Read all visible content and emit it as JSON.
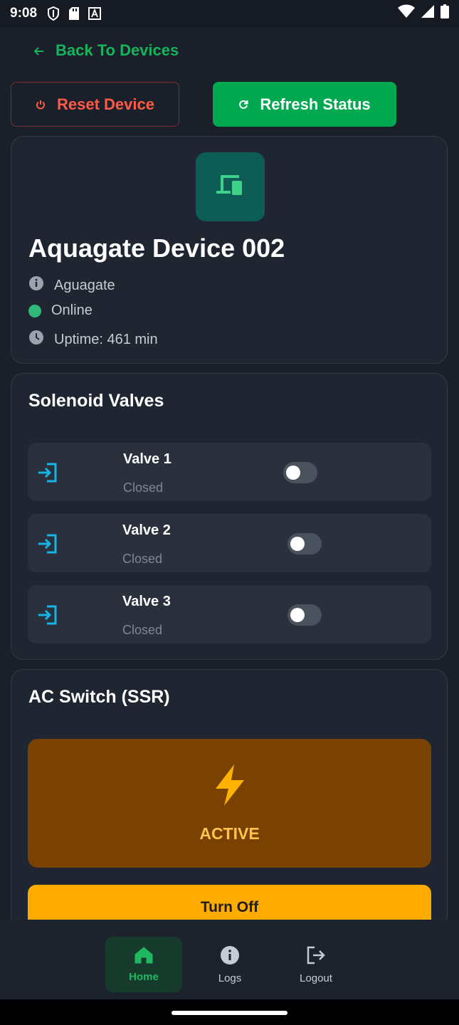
{
  "status_bar": {
    "time": "9:08",
    "icons": [
      "shield-icon",
      "sd-card-icon",
      "font-a-icon"
    ],
    "right_icons": [
      "wifi-icon",
      "signal-icon",
      "battery-icon"
    ]
  },
  "header": {
    "back_label": "Back To Devices"
  },
  "actions": {
    "reset_label": "Reset Device",
    "refresh_label": "Refresh Status"
  },
  "device": {
    "name": "Aquagate Device 002",
    "type": "Aguagate",
    "status": "Online",
    "uptime": "Uptime: 461 min",
    "icon": "devices-icon",
    "accent": "#0e5c56"
  },
  "valves": {
    "title": "Solenoid Valves",
    "items": [
      {
        "name": "Valve 1",
        "state": "Closed",
        "on": false
      },
      {
        "name": "Valve 2",
        "state": "Closed",
        "on": false
      },
      {
        "name": "Valve 3",
        "state": "Closed",
        "on": false
      }
    ]
  },
  "ac_switch": {
    "title": "AC Switch (SSR)",
    "status": "ACTIVE",
    "button_label": "Turn Off",
    "panel_color": "#7a4200",
    "button_color": "#ffab00"
  },
  "nav": {
    "items": [
      {
        "label": "Home",
        "icon": "home-icon",
        "active": true
      },
      {
        "label": "Logs",
        "icon": "info-icon",
        "active": false
      },
      {
        "label": "Logout",
        "icon": "logout-icon",
        "active": false
      }
    ]
  },
  "colors": {
    "background": "#1a202a",
    "card": "#1f2631",
    "primary_green": "#00a94f",
    "danger": "#ff5a45",
    "online": "#2fb87a"
  }
}
